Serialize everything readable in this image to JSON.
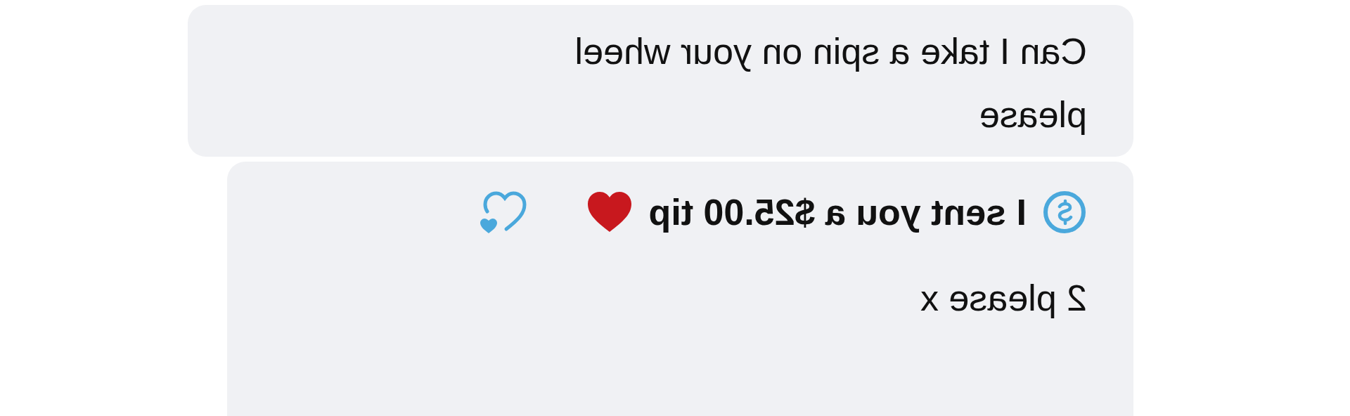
{
  "messages": [
    {
      "kind": "text",
      "lines": [
        "Can I take a spin on your wheel",
        "please"
      ]
    },
    {
      "kind": "tip",
      "lines": [
        "I sent you a $25.00 tip",
        "2 please x"
      ]
    }
  ]
}
